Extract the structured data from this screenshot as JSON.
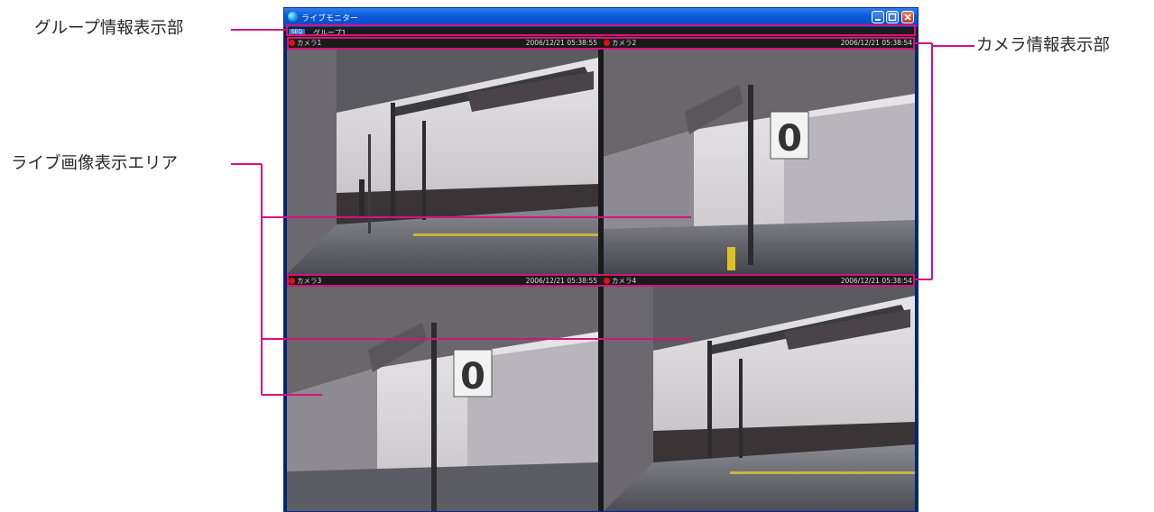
{
  "callouts": {
    "group_info": "グループ情報表示部",
    "live_area": "ライブ画像表示エリア",
    "camera_info": "カメラ情報表示部"
  },
  "window": {
    "title": "ライブモニター",
    "min_icon": "minimize-icon",
    "max_icon": "maximize-icon",
    "close_icon": "close-icon"
  },
  "groupbar": {
    "seq_label": "SEQ",
    "group_name": "グループ1"
  },
  "cameras": [
    {
      "name": "カメラ1",
      "timestamp": "2006/12/21 05:38:55",
      "status_color": "#e01010"
    },
    {
      "name": "カメラ2",
      "timestamp": "2006/12/21 05:38:54",
      "status_color": "#e01010"
    },
    {
      "name": "カメラ3",
      "timestamp": "2006/12/21 05:38:55",
      "status_color": "#e01010"
    },
    {
      "name": "カメラ4",
      "timestamp": "2006/12/21 05:38:54",
      "status_color": "#e01010"
    }
  ],
  "scene": {
    "platform_sign": "0"
  },
  "colors": {
    "callout_line": "#d8127a",
    "titlebar": "#0a5bd8",
    "status_dot": "#e01010"
  }
}
